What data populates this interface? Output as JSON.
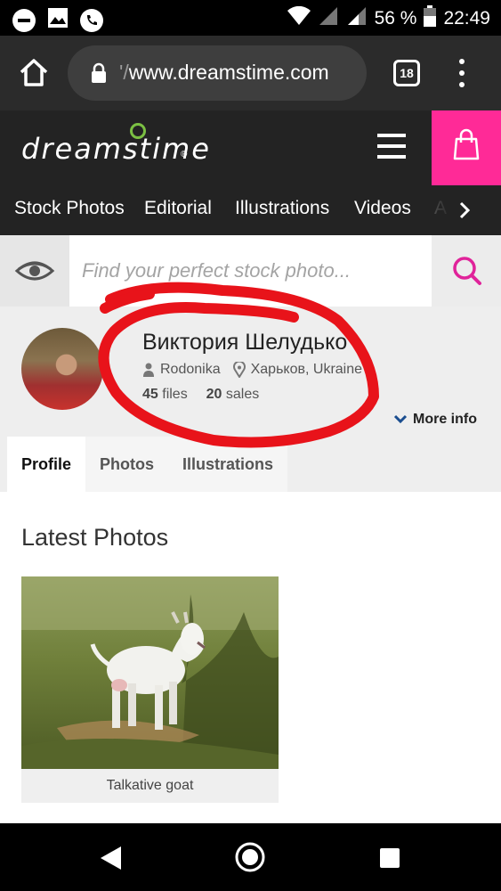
{
  "status_bar": {
    "battery": "56 %",
    "time": "22:49"
  },
  "browser": {
    "url_dim": "'/",
    "url_main": "www.dreamstime.com",
    "tab_count": "18"
  },
  "site": {
    "logo_text": "dreamstime",
    "logo_mark": "®"
  },
  "categories": [
    "Stock Photos",
    "Editorial",
    "Illustrations",
    "Videos",
    "A"
  ],
  "search": {
    "placeholder": "Find your perfect stock photo..."
  },
  "profile": {
    "name": "Виктория Шелудько",
    "username": "Rodonika",
    "location": "Харьков, Ukraine",
    "files_count": "45",
    "files_label": "files",
    "sales_count": "20",
    "sales_label": "sales",
    "more_info": "More info"
  },
  "tabs": [
    "Profile",
    "Photos",
    "Illustrations"
  ],
  "content": {
    "section_title": "Latest Photos",
    "photos": [
      {
        "caption": "Talkative goat"
      }
    ]
  },
  "colors": {
    "brand_pink": "#ff2a97",
    "logo_green": "#7bc043",
    "annotation_red": "#e8131a",
    "link_blue": "#1a4d8f"
  }
}
